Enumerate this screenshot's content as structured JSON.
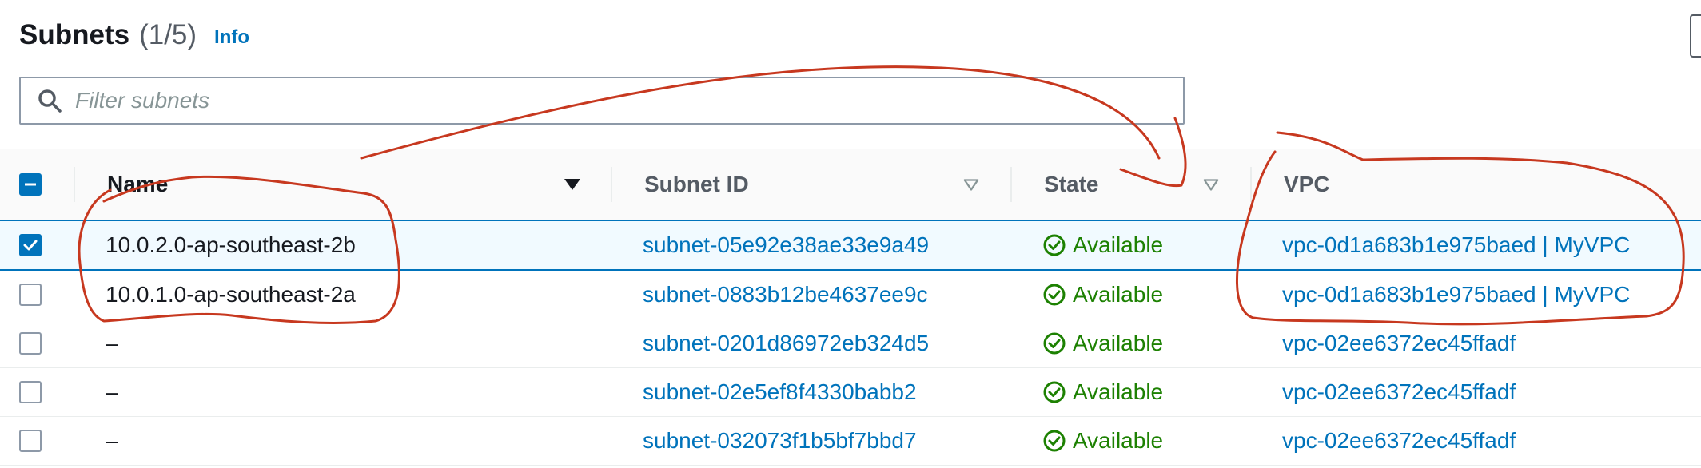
{
  "header": {
    "title": "Subnets",
    "count": "(1/5)",
    "info_label": "Info"
  },
  "search": {
    "placeholder": "Filter subnets",
    "value": ""
  },
  "table": {
    "columns": {
      "name": "Name",
      "subnet_id": "Subnet ID",
      "state": "State",
      "vpc": "VPC"
    },
    "rows": [
      {
        "selected": true,
        "name": "10.0.2.0-ap-southeast-2b",
        "subnet_id": "subnet-05e92e38ae33e9a49",
        "state": "Available",
        "vpc": "vpc-0d1a683b1e975baed | MyVPC"
      },
      {
        "selected": false,
        "name": "10.0.1.0-ap-southeast-2a",
        "subnet_id": "subnet-0883b12be4637ee9c",
        "state": "Available",
        "vpc": "vpc-0d1a683b1e975baed | MyVPC"
      },
      {
        "selected": false,
        "name": "–",
        "subnet_id": "subnet-0201d86972eb324d5",
        "state": "Available",
        "vpc": "vpc-02ee6372ec45ffadf"
      },
      {
        "selected": false,
        "name": "–",
        "subnet_id": "subnet-02e5ef8f4330babb2",
        "state": "Available",
        "vpc": "vpc-02ee6372ec45ffadf"
      },
      {
        "selected": false,
        "name": "–",
        "subnet_id": "subnet-032073f1b5bf7bbd7",
        "state": "Available",
        "vpc": "vpc-02ee6372ec45ffadf"
      }
    ]
  },
  "icons": {
    "search": "search-icon",
    "sort_active": "caret-down-filled-icon",
    "sort_inactive": "caret-down-outline-icon",
    "status_ok": "check-circle-icon",
    "checkbox_checked": "checkmark-icon",
    "checkbox_indeterminate": "dash-icon"
  },
  "colors": {
    "accent": "#0073bb",
    "success": "#1d8102",
    "annotation": "#c7381f"
  }
}
